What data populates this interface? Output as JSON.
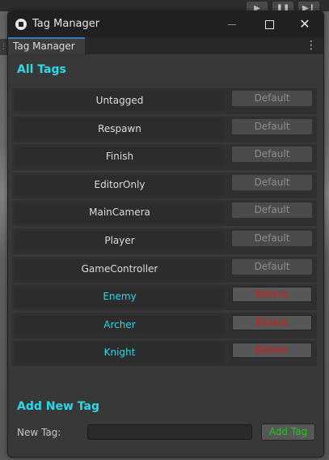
{
  "backdrop": {
    "toolbar_buttons": [
      "▶",
      "❚❚",
      "▶❙"
    ],
    "left_icon": "⋮⋮"
  },
  "window": {
    "title": "Tag Manager",
    "close_glyph": "✕"
  },
  "tab": {
    "label": "Tag Manager",
    "menu_glyph": "⋮"
  },
  "all_tags": {
    "heading": "All Tags",
    "rows": [
      {
        "name": "Untagged",
        "action": "Default",
        "kind": "default"
      },
      {
        "name": "Respawn",
        "action": "Default",
        "kind": "default"
      },
      {
        "name": "Finish",
        "action": "Default",
        "kind": "default"
      },
      {
        "name": "EditorOnly",
        "action": "Default",
        "kind": "default"
      },
      {
        "name": "MainCamera",
        "action": "Default",
        "kind": "default"
      },
      {
        "name": "Player",
        "action": "Default",
        "kind": "default"
      },
      {
        "name": "GameController",
        "action": "Default",
        "kind": "default"
      },
      {
        "name": "Enemy",
        "action": "Delete",
        "kind": "custom"
      },
      {
        "name": "Archer",
        "action": "Delete",
        "kind": "custom"
      },
      {
        "name": "Knight",
        "action": "Delete",
        "kind": "custom"
      }
    ]
  },
  "add_new": {
    "heading": "Add New Tag",
    "label": "New Tag:",
    "value": "",
    "button": "Add Tag"
  },
  "colors": {
    "accent": "#2ad9ea",
    "delete": "#d21e1e",
    "add": "#22c322"
  }
}
